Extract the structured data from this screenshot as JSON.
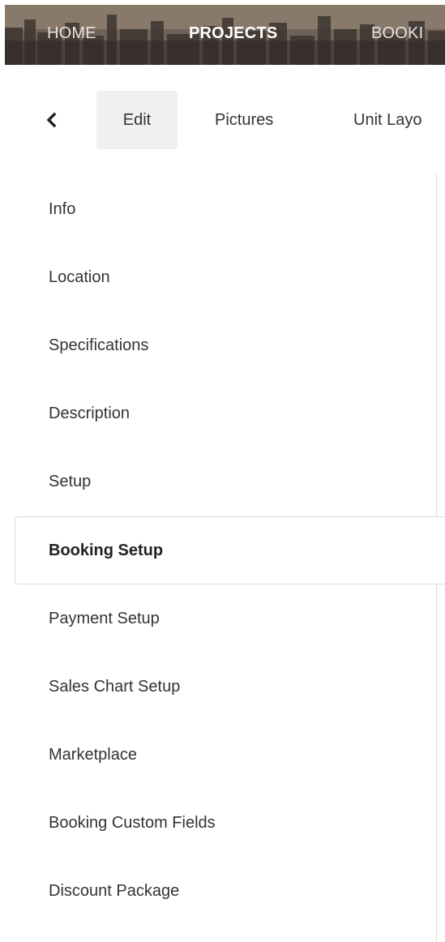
{
  "topnav": {
    "items": [
      {
        "label": "HOME",
        "active": false
      },
      {
        "label": "PROJECTS",
        "active": true
      },
      {
        "label": "BOOKI",
        "active": false
      }
    ]
  },
  "subtabs": {
    "back_icon": "chevron-left-icon",
    "items": [
      {
        "label": "Edit",
        "active": true
      },
      {
        "label": "Pictures",
        "active": false
      },
      {
        "label": "Unit Layo",
        "active": false
      }
    ]
  },
  "side_menu": {
    "items": [
      {
        "label": "Info",
        "active": false
      },
      {
        "label": "Location",
        "active": false
      },
      {
        "label": "Specifications",
        "active": false
      },
      {
        "label": "Description",
        "active": false
      },
      {
        "label": "Setup",
        "active": false
      },
      {
        "label": "Booking Setup",
        "active": true
      },
      {
        "label": "Payment Setup",
        "active": false
      },
      {
        "label": "Sales Chart Setup",
        "active": false
      },
      {
        "label": "Marketplace",
        "active": false
      },
      {
        "label": "Booking Custom Fields",
        "active": false
      },
      {
        "label": "Discount Package",
        "active": false
      }
    ]
  },
  "colors": {
    "text": "#333333",
    "active_tab_bg": "#f0f0f0",
    "border": "#dddddd",
    "nav_text": "#e8e4e0"
  }
}
